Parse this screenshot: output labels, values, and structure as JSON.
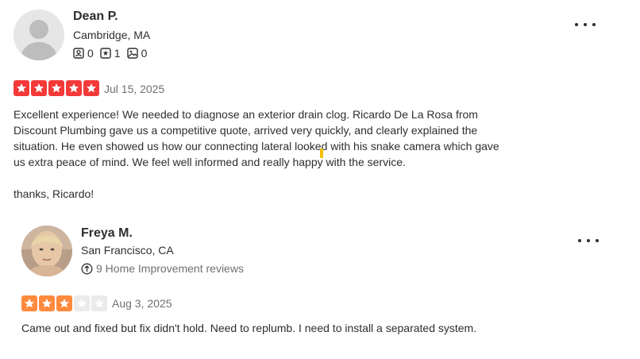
{
  "reviews": [
    {
      "name": "Dean P.",
      "location": "Cambridge, MA",
      "stats": {
        "friends": "0",
        "reviews": "1",
        "photos": "0"
      },
      "rating": 5,
      "star_color": "#f43939",
      "date": "Jul 15, 2025",
      "text_lines": [
        "Excellent experience! We needed to diagnose an exterior drain clog. Ricardo De La Rosa from",
        "Discount Plumbing gave us a competitive quote, arrived very quickly, and clearly explained the",
        "situation. He even showed us how our connecting lateral looked with his snake camera which gave",
        "us extra peace of mind. We feel well informed and really happy with the service."
      ],
      "closing": "thanks, Ricardo!"
    },
    {
      "name": "Freya M.",
      "location": "San Francisco, CA",
      "badge": "9 Home Improvement reviews",
      "rating": 3,
      "star_color": "#ff8a3d",
      "date": "Aug 3, 2025",
      "text": "Came out and fixed but fix didn't hold. Need to replumb. I need to install a separated system."
    }
  ]
}
